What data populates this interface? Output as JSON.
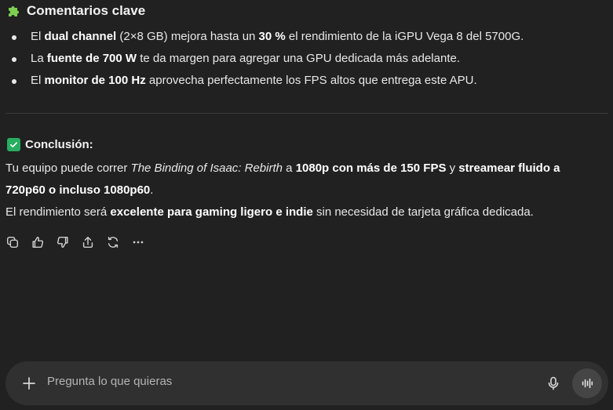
{
  "section": {
    "icon": "puzzle-piece-icon",
    "title": "Comentarios clave"
  },
  "bullets": [
    {
      "pre": "El ",
      "b1": "dual channel",
      "mid": " (2×8 GB) mejora hasta un ",
      "b2": "30 %",
      "post": " el rendimiento de la iGPU Vega 8 del 5700G."
    },
    {
      "pre": "La ",
      "b1": "fuente de 700 W",
      "post": " te da margen para agregar una GPU dedicada más adelante."
    },
    {
      "pre": "El ",
      "b1": "monitor de 100 Hz",
      "post": " aprovecha perfectamente los FPS altos que entrega este APU."
    }
  ],
  "conclusion": {
    "icon": "check-mark-button-icon",
    "title": "Conclusión:",
    "line1": {
      "pre": "Tu equipo puede correr ",
      "italic": "The Binding of Isaac: Rebirth",
      "mid": " a ",
      "b1": "1080p con más de 150 FPS",
      "and": " y ",
      "b2": "streamear fluido a"
    },
    "line2": {
      "b": "720p60 o incluso 1080p60",
      "post": "."
    },
    "line3": {
      "pre": "El rendimiento será ",
      "b": "excelente para gaming ligero e indie",
      "post": " sin necesidad de tarjeta gráfica dedicada."
    }
  },
  "actions": [
    "copy-icon",
    "thumbs-up-icon",
    "thumbs-down-icon",
    "share-icon",
    "regenerate-icon",
    "more-icon"
  ],
  "composer": {
    "placeholder": "Pregunta lo que quieras"
  }
}
